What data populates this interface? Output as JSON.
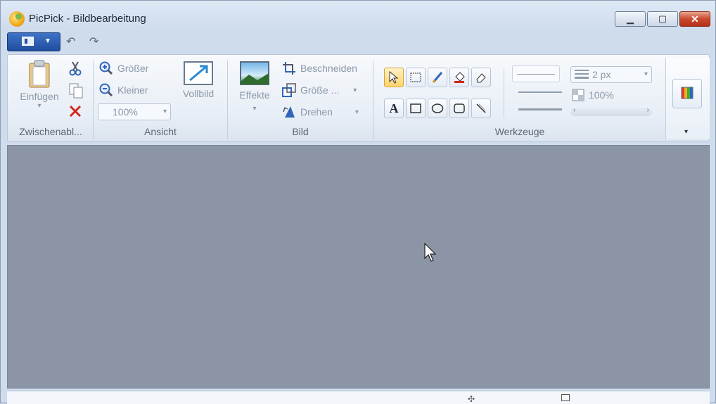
{
  "window": {
    "title": "PicPick - Bildbearbeitung"
  },
  "ribbon": {
    "clipboard": {
      "paste_label": "Einfügen",
      "group_label": "Zwischenabl..."
    },
    "view": {
      "zoom_in": "Größer",
      "zoom_out": "Kleiner",
      "fullscreen": "Vollbild",
      "zoom_value": "100%",
      "group_label": "Ansicht"
    },
    "image": {
      "effects": "Effekte",
      "crop": "Beschneiden",
      "resize": "Größe ...",
      "rotate": "Drehen",
      "group_label": "Bild"
    },
    "tools": {
      "group_label": "Werkzeuge",
      "line_width": "2 px",
      "opacity": "100%"
    }
  },
  "colors": {
    "canvas": "#8b95a5",
    "accent": "#1f4e9e",
    "close": "#c94a2f"
  },
  "icons": [
    "app-logo-icon",
    "app-menu-icon",
    "undo-icon",
    "redo-icon",
    "paste-icon",
    "cut-icon",
    "copy-icon",
    "delete-icon",
    "zoom-in-icon",
    "zoom-out-icon",
    "fullscreen-icon",
    "effects-icon",
    "crop-icon",
    "resize-icon",
    "rotate-icon",
    "pointer-tool-icon",
    "rect-select-icon",
    "pen-icon",
    "fill-icon",
    "eraser-icon",
    "text-tool-icon",
    "rectangle-icon",
    "ellipse-icon",
    "rounded-rect-icon",
    "line-tool-icon",
    "color-palette-icon"
  ]
}
